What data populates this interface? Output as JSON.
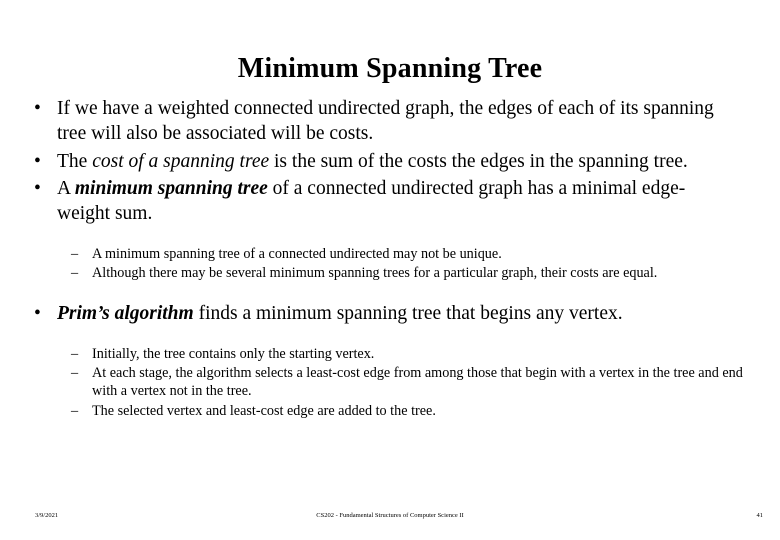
{
  "slide": {
    "title": "Minimum Spanning Tree",
    "bullets": [
      {
        "level": 1,
        "marker": "•",
        "parts": [
          {
            "text": "If we have  a weighted connected undirected graph, the edges of each of its spanning tree will also be associated will be costs.",
            "style": "normal"
          }
        ]
      },
      {
        "level": 1,
        "marker": "•",
        "parts": [
          {
            "text": "The ",
            "style": "normal"
          },
          {
            "text": "cost of a spanning tree",
            "style": "italic"
          },
          {
            "text": " is the sum of the costs the edges in the spanning tree.",
            "style": "normal"
          }
        ]
      },
      {
        "level": 1,
        "marker": "•",
        "parts": [
          {
            "text": "A ",
            "style": "normal"
          },
          {
            "text": "minimum spanning tree",
            "style": "bold-italic"
          },
          {
            "text": " of a connected undirected graph has a minimal edge-weight sum.",
            "style": "normal"
          }
        ]
      },
      {
        "level": 2,
        "marker": "–",
        "parts": [
          {
            "text": "A minimum spanning tree of a connected undirected may not be unique.",
            "style": "normal"
          }
        ]
      },
      {
        "level": 2,
        "marker": "–",
        "parts": [
          {
            "text": "Although there may be several minimum spanning trees for a particular graph, their costs are equal.",
            "style": "normal"
          }
        ]
      },
      {
        "level": 1,
        "marker": "•",
        "parts": [
          {
            "text": "Prim’s algorithm",
            "style": "bold-italic"
          },
          {
            "text": "  finds a minimum spanning tree that begins any vertex.",
            "style": "normal"
          }
        ]
      },
      {
        "level": 2,
        "marker": "–",
        "parts": [
          {
            "text": "Initially, the tree contains only the starting vertex.",
            "style": "normal"
          }
        ]
      },
      {
        "level": 2,
        "marker": "–",
        "parts": [
          {
            "text": "At each stage, the algorithm selects a least-cost edge from among those that begin with a vertex in the tree and end with a vertex not in the tree.",
            "style": "normal"
          }
        ]
      },
      {
        "level": 2,
        "marker": "–",
        "parts": [
          {
            "text": "The selected vertex and least-cost edge are added to the tree.",
            "style": "normal"
          }
        ]
      }
    ]
  },
  "footer": {
    "date": "3/9/2021",
    "course": "CS202 - Fundamental Structures of Computer Science II",
    "page_number": "41"
  },
  "colors": {
    "background": "#ffffff",
    "text": "#000000"
  }
}
